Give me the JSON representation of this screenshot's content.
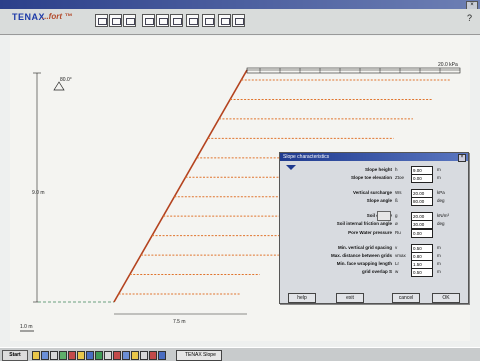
{
  "app": {
    "logo": "TENAX",
    "logo_sub": "...fort ™"
  },
  "toolbar": {
    "icons": [
      "open-icon",
      "save-icon",
      "grid-icon",
      "data-icon",
      "table-icon",
      "print-icon",
      "calc-icon",
      "report-icon",
      "info-icon"
    ],
    "help": "?"
  },
  "drawing": {
    "top_label": "20.0 kPa",
    "height_label": "9.0 m",
    "base_label": "7.5 m",
    "scale_label": "1.0 m",
    "slope_label": "80.0°",
    "grid_count": 12
  },
  "dialog": {
    "title": "Slope characteristics",
    "fields": [
      {
        "label": "Slope height",
        "sym": "h",
        "value": "9.00",
        "unit": "m"
      },
      {
        "label": "Slope toe elevation",
        "sym": "Ztoe",
        "value": "0.00",
        "unit": "m"
      },
      {
        "label": "Vertical surcharge",
        "sym": "Ws",
        "value": "20.00",
        "unit": "kPa"
      },
      {
        "label": "Slope angle",
        "sym": "ß",
        "value": "80.00",
        "unit": "deg"
      },
      {
        "label": "Soil density",
        "sym": "g",
        "value": "20.00",
        "unit": "kN/m³"
      },
      {
        "label": "Soil internal friction angle",
        "sym": "ø",
        "value": "30.00",
        "unit": "deg"
      },
      {
        "label": "Pore Water pressure",
        "sym": "Ru",
        "value": "0.00",
        "unit": ""
      },
      {
        "label": "Min. vertical grid spacing",
        "sym": "v",
        "value": "0.50",
        "unit": "m"
      },
      {
        "label": "Max. distance between grids",
        "sym": "vmax",
        "value": "0.80",
        "unit": "m"
      },
      {
        "label": "Min. face wrapping length",
        "sym": "Lr",
        "value": "1.50",
        "unit": "m"
      },
      {
        "label": "grid overlap S",
        "sym": "w",
        "value": "0.50",
        "unit": "m"
      }
    ],
    "buttons": {
      "help": "help",
      "exit": "exit",
      "cancel": "cancel",
      "ok": "OK"
    }
  },
  "taskbar": {
    "start": "Start",
    "task": "TENAX Slope"
  },
  "colors": {
    "slope": "#b4431f",
    "grid": "#e0742d",
    "ground": "#6aa07f",
    "dimension": "#222222"
  }
}
